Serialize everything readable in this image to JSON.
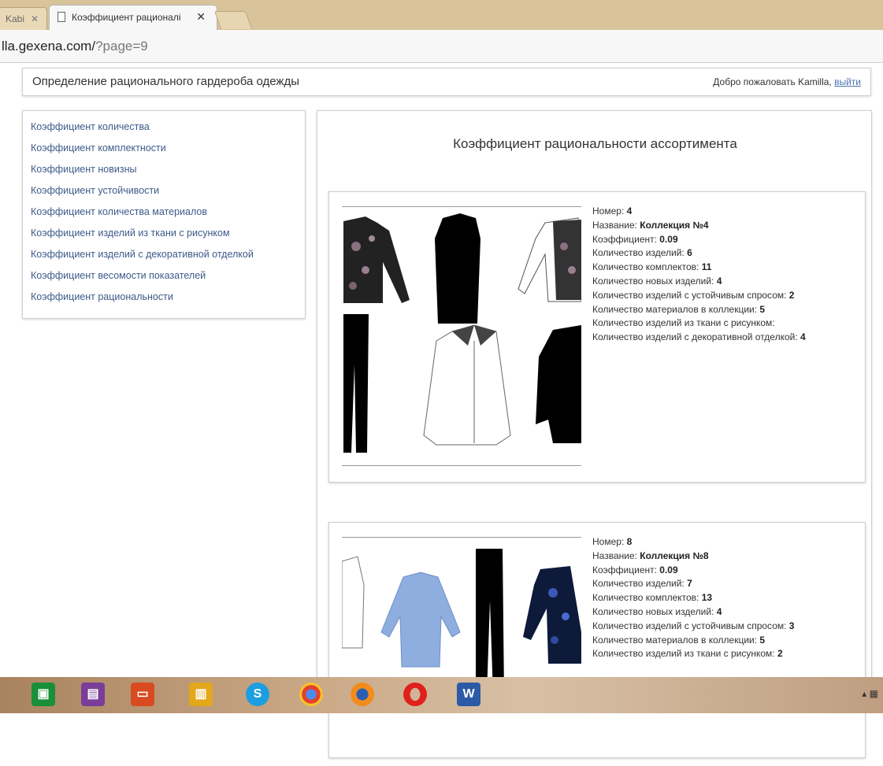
{
  "browser": {
    "prev_tab_label": "Kabi",
    "active_tab_title": "Коэффициент рационалі",
    "url_host": "lla.gexena.com/",
    "url_path": "?page=9"
  },
  "header": {
    "site_title": "Определение рационального гардероба одежды",
    "welcome_text": "Добро пожаловать Kamilla,",
    "logout_link": "выйти"
  },
  "sidebar": {
    "items": [
      "Коэффициент количества",
      "Коэффициент комплектности",
      "Коэффициент новизны",
      "Коэффициент устойчивости",
      "Коэффициент количества материалов",
      "Коэффициент изделий из ткани с рисунком",
      "Коэффициент изделий с декоративной отделкой",
      "Коэффициент весомости показателей",
      "Коэффициент рациональности"
    ]
  },
  "main": {
    "title": "Коэффициент рациональности ассортимента",
    "collections": [
      {
        "rows": [
          {
            "label": "Номер: ",
            "value": "4"
          },
          {
            "label": "Название: ",
            "value": "Коллекция №4"
          },
          {
            "label": "Коэффициент: ",
            "value": "0.09"
          },
          {
            "label": "Количество изделий: ",
            "value": "6"
          },
          {
            "label": "Количество комплектов: ",
            "value": "11"
          },
          {
            "label": "Количество новых изделий: ",
            "value": "4"
          },
          {
            "label": "Количество изделий с устойчивым спросом: ",
            "value": "2"
          },
          {
            "label": "Количество материалов в коллекции: ",
            "value": "5"
          },
          {
            "label": "Количество изделий из ткани с рисунком:",
            "value": ""
          },
          {
            "label": "Количество изделий с декоративной отделкой: ",
            "value": "4"
          }
        ]
      },
      {
        "rows": [
          {
            "label": "Номер: ",
            "value": "8"
          },
          {
            "label": "Название: ",
            "value": "Коллекция №8"
          },
          {
            "label": "Коэффициент: ",
            "value": "0.09"
          },
          {
            "label": "Количество изделий: ",
            "value": "7"
          },
          {
            "label": "Количество комплектов: ",
            "value": "13"
          },
          {
            "label": "Количество новых изделий: ",
            "value": "4"
          },
          {
            "label": "Количество изделий с устойчивым спросом: ",
            "value": "3"
          },
          {
            "label": "Количество материалов в коллекции: ",
            "value": "5"
          },
          {
            "label": "Количество изделий из ткани с рисунком: ",
            "value": "2"
          }
        ]
      }
    ]
  },
  "taskbar": {
    "icons": [
      "store-icon",
      "onenote-icon",
      "photos-icon",
      "files-icon",
      "skype-icon",
      "chrome-icon",
      "firefox-icon",
      "opera-icon",
      "word-icon"
    ],
    "skype_letter": "S",
    "word_letter": "W"
  }
}
